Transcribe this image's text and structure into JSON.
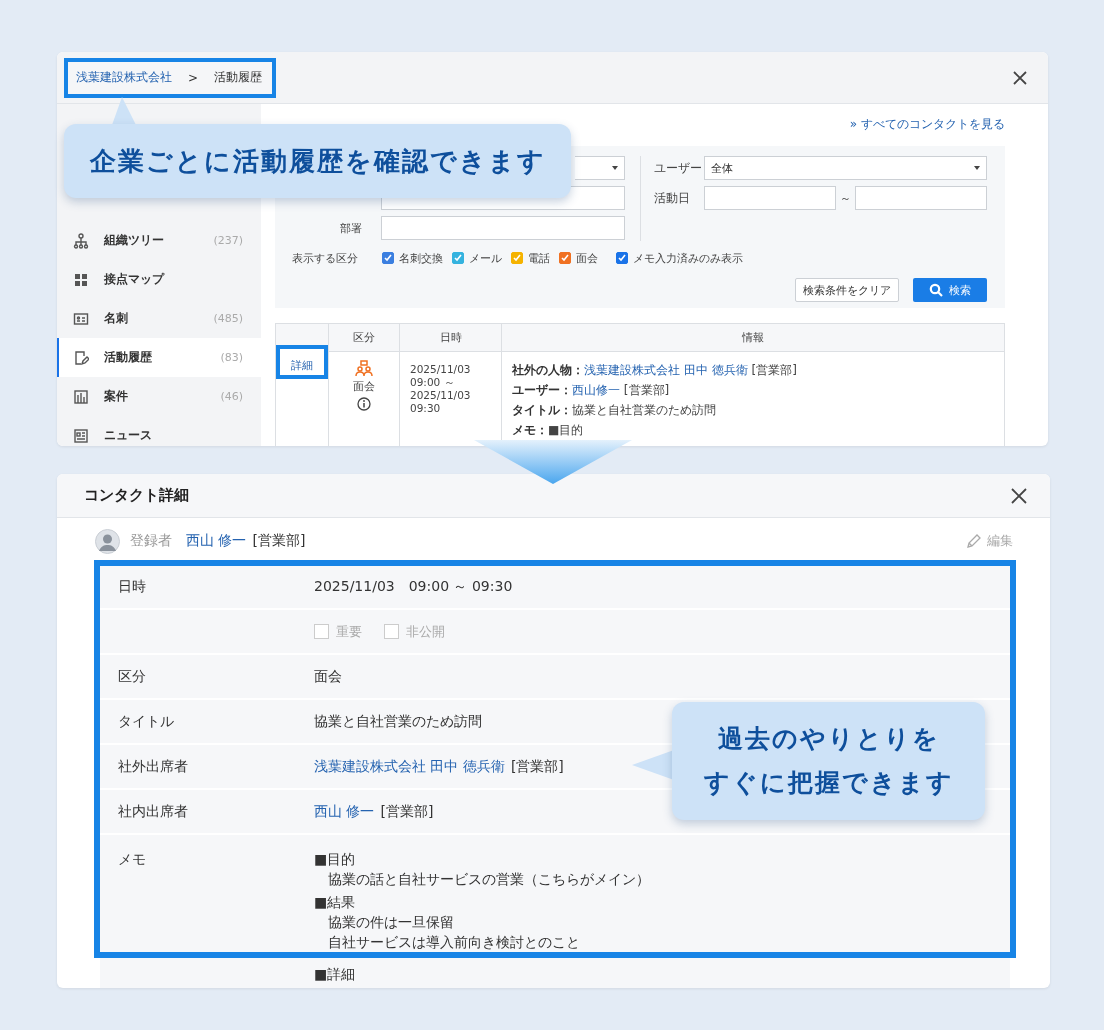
{
  "top_window": {
    "breadcrumb": [
      {
        "kind": "link",
        "label": "浅葉建設株式会社"
      },
      {
        "kind": "separator",
        "label": ">"
      },
      {
        "kind": "current",
        "label": "活動履歴"
      }
    ],
    "sidebar": {
      "items": [
        {
          "label": "組織ツリー",
          "count": "(237)",
          "selected": false
        },
        {
          "label": "接点マップ",
          "selected": false
        },
        {
          "label": "名刺",
          "count": "(485)",
          "selected": false
        },
        {
          "label": "活動履歴",
          "count": "(83)",
          "selected": true
        },
        {
          "label": "案件",
          "count": "(46)",
          "selected": false
        },
        {
          "label": "ニュース",
          "selected": false
        }
      ]
    },
    "all_contacts_link": "» すべてのコンタクトを見る",
    "filters": {
      "department_label": "部署",
      "user_label": "ユーザー",
      "user_value": "全体",
      "date_label": "活動日",
      "date_separator": "～",
      "categories_label": "表示する区分",
      "categories": [
        {
          "label": "名刺交換",
          "checked": true,
          "color": "#3b7fe0"
        },
        {
          "label": "メール",
          "checked": true,
          "color": "#35b3df"
        },
        {
          "label": "電話",
          "checked": true,
          "color": "#f5b300"
        },
        {
          "label": "面会",
          "checked": true,
          "color": "#f07122"
        },
        {
          "label": "メモ入力済みのみ表示",
          "checked": true,
          "color": "#1a73e8"
        }
      ],
      "clear_button": "検索条件をクリア",
      "search_button": "検索"
    },
    "table": {
      "columns": [
        "区分",
        "日時",
        "情報"
      ],
      "rows": [
        {
          "detail_link": "詳細",
          "category": "面会",
          "datetime": [
            "2025/11/03",
            "09:00 ～",
            "2025/11/03",
            "09:30"
          ],
          "info": [
            {
              "label": "社外の人物：",
              "link": "浅葉建設株式会社 田中 徳兵衛",
              "suffix": "[営業部]"
            },
            {
              "label": "ユーザー：",
              "link": "西山修一",
              "suffix": "[営業部]"
            },
            {
              "label": "タイトル：",
              "text": "協業と自社営業のため訪問"
            },
            {
              "label": "メモ：",
              "text": "■目的"
            }
          ]
        }
      ]
    }
  },
  "callouts": [
    {
      "lines": [
        "企業ごとに活動履歴を確認できます"
      ]
    },
    {
      "lines": [
        "過去のやりとりを",
        "すぐに把握できます"
      ]
    }
  ],
  "detail_window": {
    "title": "コンタクト詳細",
    "registrant": {
      "label": "登録者",
      "name": "西山 修一",
      "department": "[営業部]"
    },
    "edit_button": "編集",
    "fields": [
      {
        "kind": "text",
        "label": "日時",
        "value": "2025/11/03　09:00 ～ 09:30"
      },
      {
        "kind": "checks",
        "options": [
          {
            "label": "重要",
            "checked": false,
            "disabled": true
          },
          {
            "label": "非公開",
            "checked": false,
            "disabled": true
          }
        ]
      },
      {
        "kind": "text",
        "label": "区分",
        "value": "面会"
      },
      {
        "kind": "text",
        "label": "タイトル",
        "value": "協業と自社営業のため訪問"
      },
      {
        "kind": "link",
        "label": "社外出席者",
        "link": "浅葉建設株式会社 田中 徳兵衛",
        "suffix": "[営業部]"
      },
      {
        "kind": "link",
        "label": "社内出席者",
        "link": "西山 修一",
        "suffix": "[営業部]"
      },
      {
        "kind": "memo",
        "label": "メモ",
        "lines": [
          {
            "kind": "heading",
            "text": "■目的"
          },
          {
            "kind": "body",
            "text": "協業の話と自社サービスの営業（こちらがメイン）"
          },
          {
            "kind": "heading",
            "text": "■結果"
          },
          {
            "kind": "body",
            "text": "協業の件は一旦保留"
          },
          {
            "kind": "body",
            "text": "自社サービスは導入前向き検討とのこと"
          },
          {
            "kind": "heading",
            "text": "■詳細"
          }
        ]
      }
    ]
  }
}
